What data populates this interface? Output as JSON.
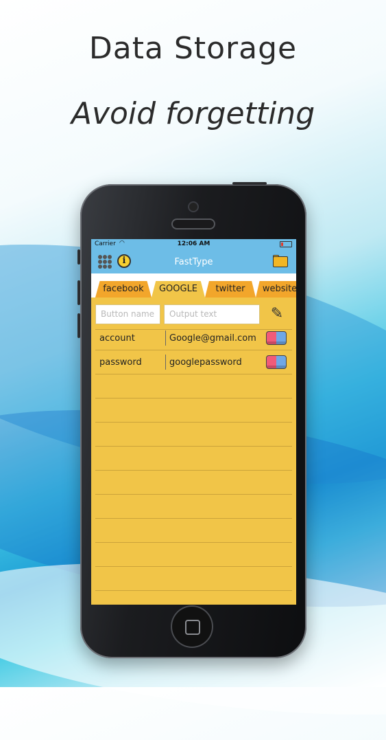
{
  "headline": {
    "line1": "Data Storage",
    "line2": "Avoid forgetting"
  },
  "status_bar": {
    "carrier": "Carrier",
    "time": "12:06 AM"
  },
  "nav": {
    "title": "FastType",
    "left_icons": [
      "grid-icon",
      "info-icon"
    ],
    "right_icon": "folder-icon"
  },
  "tabs": [
    {
      "label": "facebook",
      "selected": false
    },
    {
      "label": "GOOGLE",
      "selected": true
    },
    {
      "label": "twitter",
      "selected": false
    },
    {
      "label": "website",
      "selected": false
    }
  ],
  "inputs": {
    "button_name_placeholder": "Button name",
    "output_text_placeholder": "Output text",
    "edit_icon": "pencil-icon"
  },
  "entries": [
    {
      "label": "account",
      "value": "Google@gmail.com"
    },
    {
      "label": "password",
      "value": "googlepassword"
    }
  ],
  "colors": {
    "accent": "#6dbde7",
    "notebook": "#f1c548",
    "tab_inactive": "#f2a62b"
  }
}
